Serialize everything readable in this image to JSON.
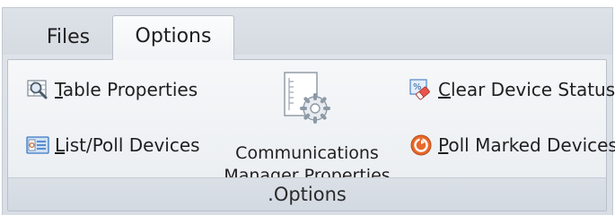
{
  "tabs": [
    {
      "label": "Files",
      "active": false
    },
    {
      "label": "Options",
      "active": true
    }
  ],
  "group": {
    "title": ".Options"
  },
  "commands": {
    "table_properties": {
      "mnemonic": "T",
      "rest": "able Properties",
      "icon": "magnifier-table-icon"
    },
    "list_poll_devices": {
      "mnemonic": "L",
      "rest": "ist/Poll Devices",
      "icon": "device-list-icon"
    },
    "comm_manager_line1": "Communications",
    "comm_manager_line2": "Manager Properties",
    "comm_manager_icon": "document-gear-icon",
    "clear_device_status": {
      "mnemonic": "C",
      "rest": "lear Device Status",
      "icon": "eraser-icon"
    },
    "poll_marked_devices": {
      "mnemonic": "P",
      "rest": "oll Marked Devices",
      "icon": "poll-orange-icon"
    }
  },
  "colors": {
    "ribbon_bg": "#eef1f4",
    "tab_strip_bg": "#d9dee5",
    "poll_orange": "#e8692a",
    "icon_blue": "#3b78c4"
  }
}
